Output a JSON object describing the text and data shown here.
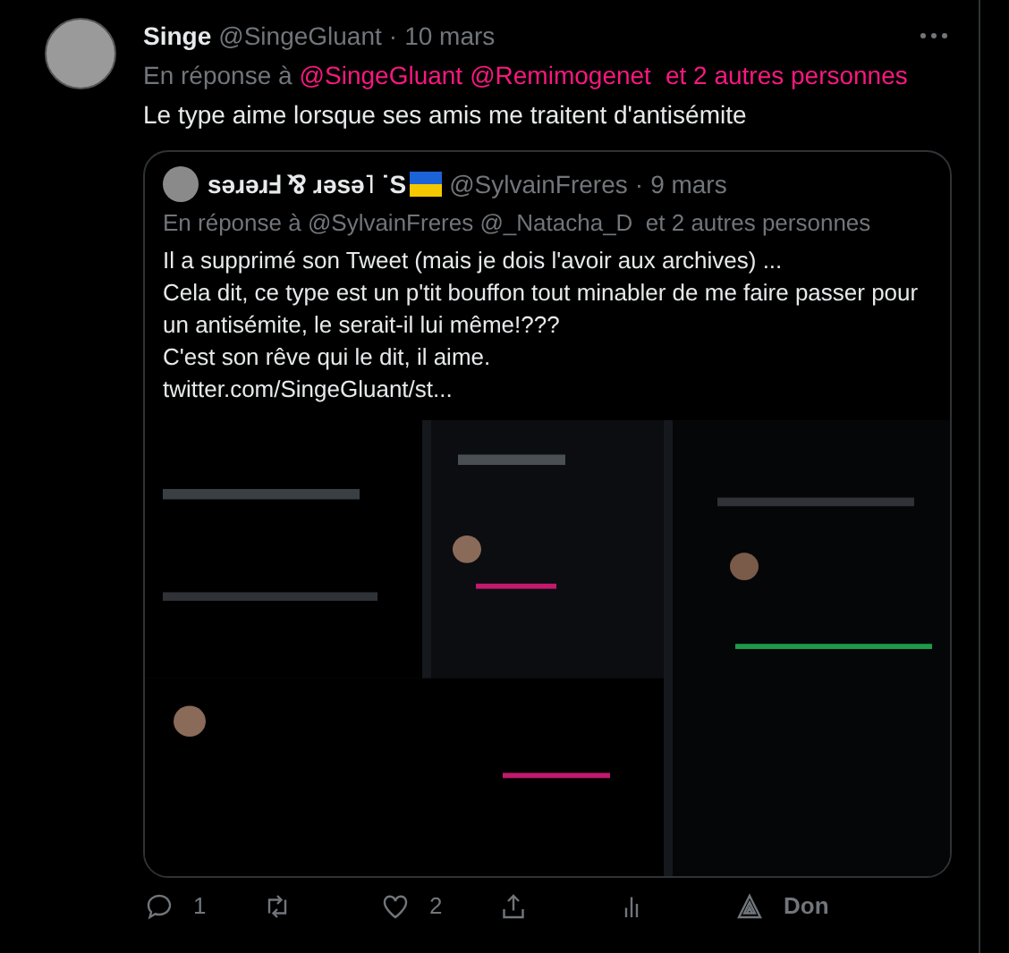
{
  "tweet": {
    "name": "Singe",
    "handle": "@SingeGluant",
    "dot": "·",
    "date": "10 mars",
    "reply_prefix": "En réponse à",
    "reply_to": [
      "@SingeGluant",
      "@Remimogenet"
    ],
    "reply_others": "et 2 autres personnes",
    "text": "Le type aime lorsque ses amis me traitent d'antisémite",
    "quote": {
      "name": "sǝɹǝɹℲ ⅋ ɹǝsǝ˥ ˙S",
      "handle": "@SylvainFreres",
      "dot": "·",
      "date": "9 mars",
      "reply": "En réponse à @SylvainFreres @_Natacha_D  et 2 autres personnes",
      "lines": [
        "Il a supprimé son Tweet (mais je dois l'avoir aux archives) ...",
        "Cela dit, ce type est un p'tit bouffon tout minabler de me faire passer pour un antisémite, le serait-il lui même!???",
        "C'est son rêve qui le dit, il aime.",
        "twitter.com/SingeGluant/st..."
      ]
    },
    "actions": [
      {
        "kind": "reply",
        "count": "1"
      },
      {
        "kind": "retweet"
      },
      {
        "kind": "like",
        "count": "2"
      },
      {
        "kind": "share"
      },
      {
        "kind": "stats"
      },
      {
        "kind": "tip",
        "label": "Don"
      }
    ]
  }
}
